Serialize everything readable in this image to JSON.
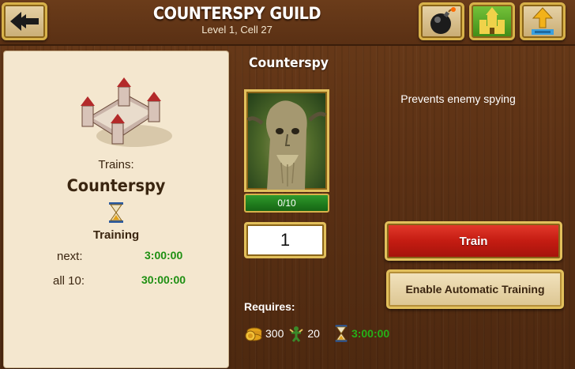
{
  "header": {
    "title": "COUNTERSPY GUILD",
    "subtitle": "Level 1, Cell 27",
    "back_icon": "back-arrow-icon",
    "bomb_icon": "bomb-icon",
    "castle_icon": "castle-icon",
    "upgrade_icon": "upgrade-arrow-icon"
  },
  "left_panel": {
    "building_icon": "castle-building-icon",
    "trains_label": "Trains:",
    "unit_name": "Counterspy",
    "hourglass_icon": "hourglass-icon",
    "training_label": "Training",
    "next_label": "next:",
    "next_value": "3:00:00",
    "all_label": "all 10:",
    "all_value": "30:00:00"
  },
  "unit": {
    "title": "Counterspy",
    "description": "Prevents enemy spying",
    "progress_text": "0/10",
    "progress_fraction": 0.0,
    "quantity": "1"
  },
  "actions": {
    "train_label": "Train",
    "auto_label": "Enable Automatic Training"
  },
  "requires": {
    "label": "Requires:",
    "gold_icon": "gold-coins-icon",
    "gold": "300",
    "people_icon": "population-icon",
    "people": "20",
    "time_icon": "hourglass-icon",
    "time": "3:00:00"
  },
  "colors": {
    "background": "#5a3014",
    "panel": "#f4e7cf",
    "gold_border": "#e2c05c",
    "train_red": "#c41c12",
    "time_green": "#1e8f12",
    "progress_green": "#1f7a1c"
  }
}
